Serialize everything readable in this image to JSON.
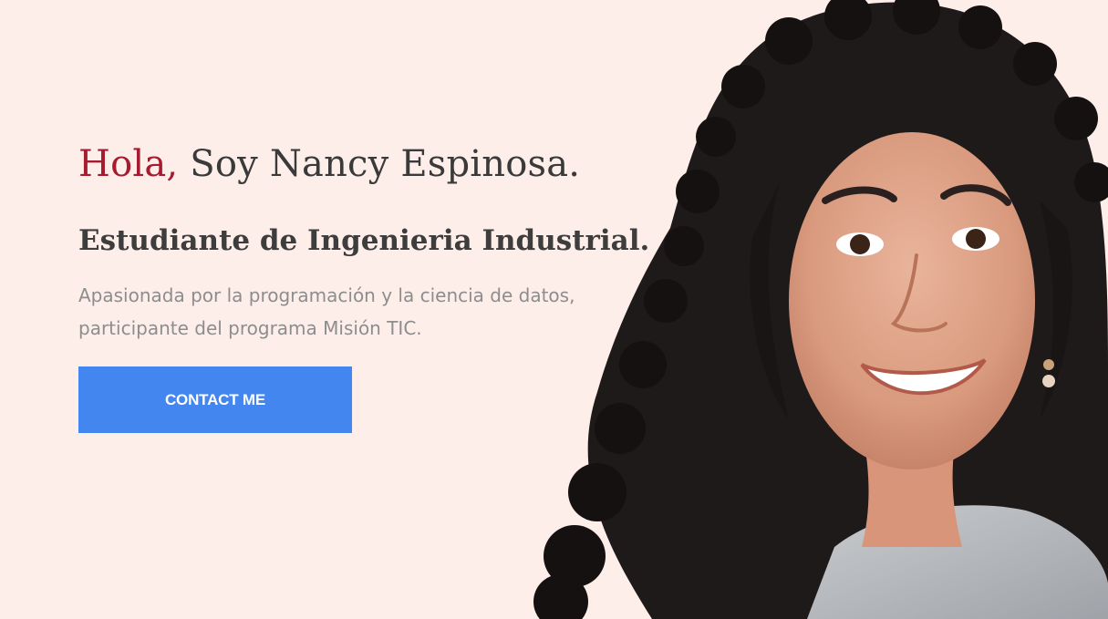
{
  "hero": {
    "greeting_accent": "Hola,",
    "greeting_rest": " Soy Nancy Espinosa.",
    "subtitle": "Estudiante de Ingenieria Industrial.",
    "bio_line1": "Apasionada por la programación y la ciencia de datos,",
    "bio_line2": "participante del programa Misión TIC.",
    "cta_label": "CONTACT ME"
  },
  "colors": {
    "background": "#fdeee9",
    "accent": "#a51c30",
    "heading": "#3a3a3a",
    "body_text": "#8d8d8d",
    "button": "#4486f0"
  },
  "portrait": {
    "icon": "person-photo"
  }
}
